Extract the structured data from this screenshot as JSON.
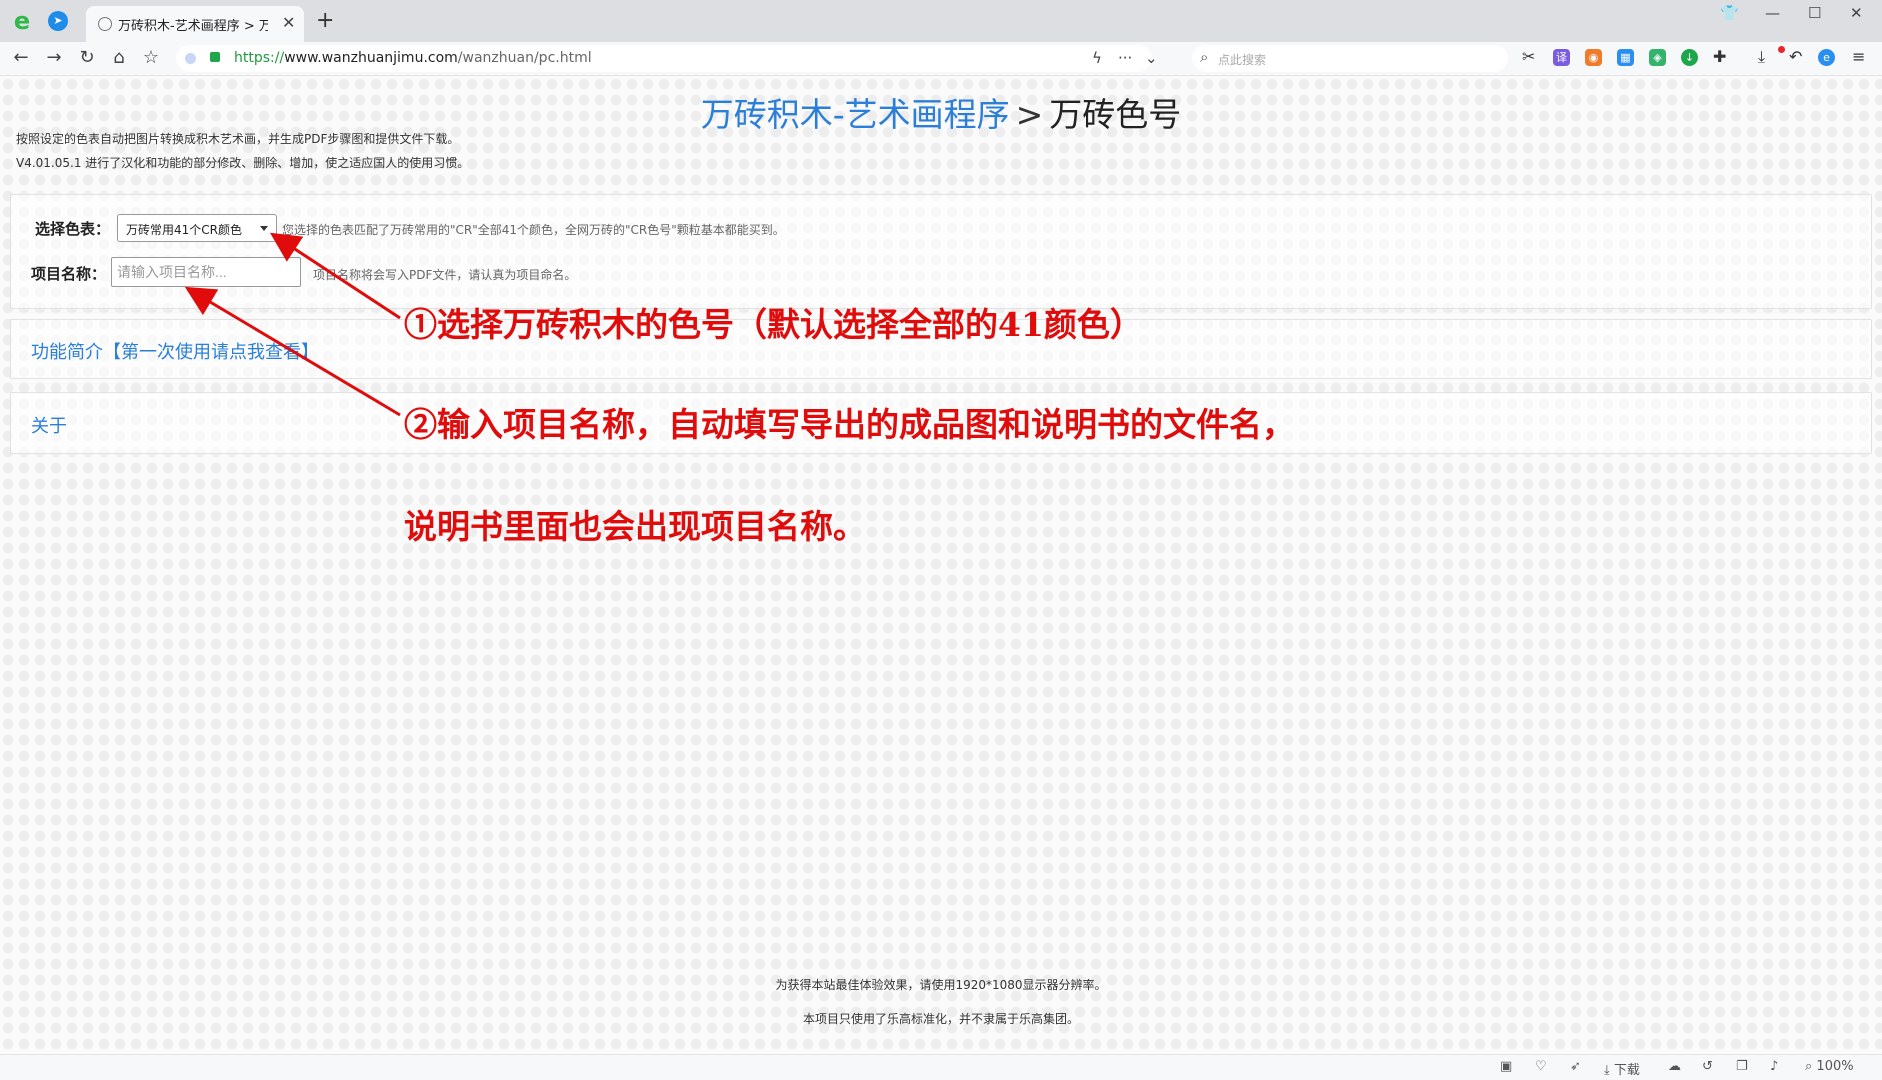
{
  "browser": {
    "tab_title": "万砖积木-艺术画程序 > 万砖色",
    "url_protocol": "https://",
    "url_host": "www.wanzhuanjimu.com",
    "url_path": "/wanzhuan/pc.html",
    "search_placeholder": "点此搜索",
    "app_logo_glyph": "e",
    "pinned_tab_glyph": "➤",
    "status_download_label": "下载",
    "status_zoom": "100%"
  },
  "page": {
    "title_link": "万砖积木-艺术画程序",
    "title_separator": ">",
    "title_current": "万砖色号",
    "intro_line1": "按照设定的色表自动把图片转换成积木艺术画，并生成PDF步骤图和提供文件下载。",
    "intro_line2": "V4.01.05.1 进行了汉化和功能的部分修改、删除、增加，使之适应国人的使用习惯。",
    "form": {
      "color_label": "选择色表：",
      "color_selected": "万砖常用41个CR颜色",
      "color_hint": "您选择的色表匹配了万砖常用的\"CR\"全部41个颜色，全网万砖的\"CR色号\"颗粒基本都能买到。",
      "project_label": "项目名称：",
      "project_placeholder": "请输入项目名称...",
      "project_value": "",
      "project_hint": "项目名称将会写入PDF文件，请认真为项目命名。"
    },
    "intro_link": "功能简介【第一次使用请点我查看】",
    "about_link": "关于",
    "footer_line1": "为获得本站最佳体验效果，请使用1920*1080显示器分辨率。",
    "footer_line2": "本项目只使用了乐高标准化，并不隶属于乐高集团。"
  },
  "annotations": {
    "step1": "①选择万砖积木的色号（默认选择全部的41颜色）",
    "step2_line1": "②输入项目名称，自动填写导出的成品图和说明书的文件名，",
    "step2_line2": "说明书里面也会出现项目名称。"
  },
  "colors": {
    "link_blue": "#2b7fd8",
    "annotation_red": "#e00b0b",
    "secure_green": "#1f9a3e"
  }
}
